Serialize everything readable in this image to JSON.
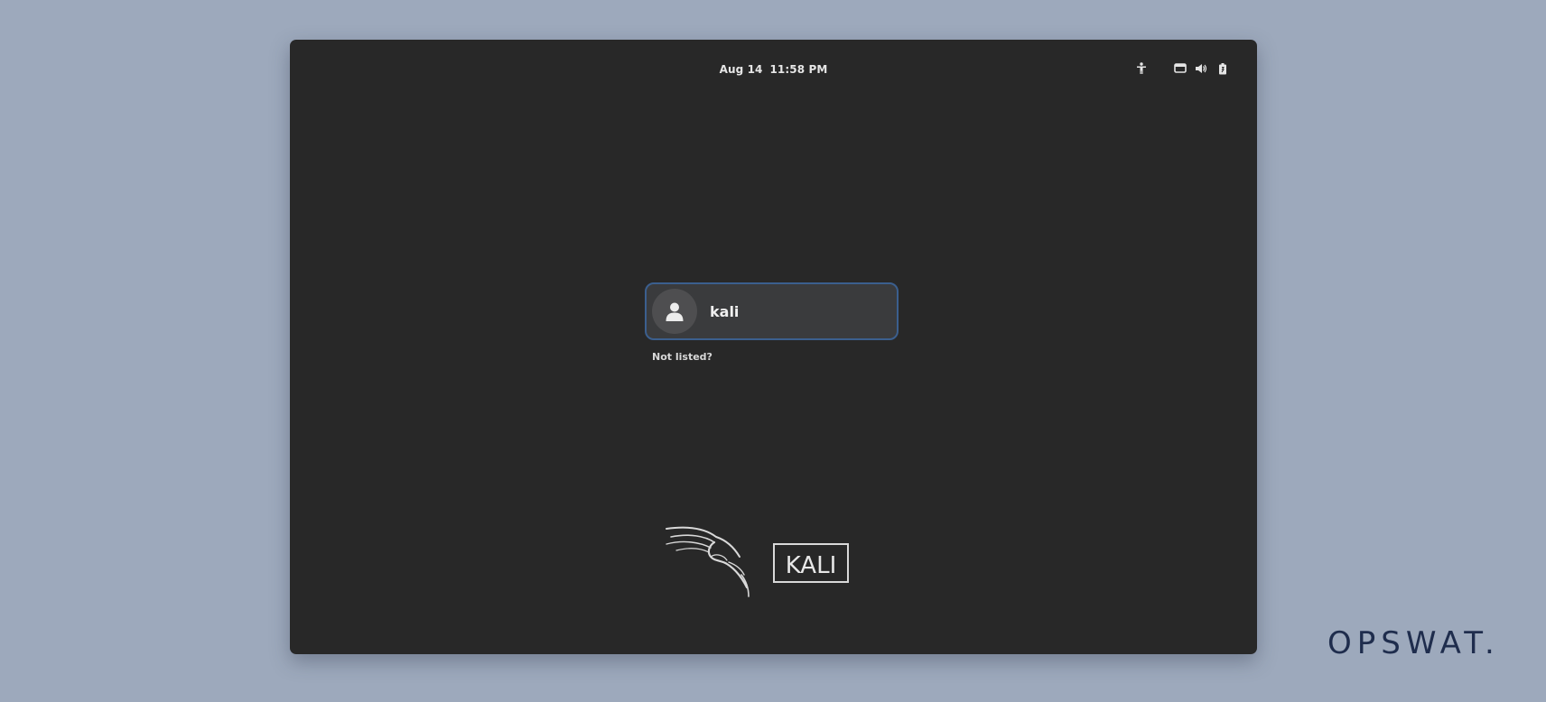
{
  "topbar": {
    "date": "Aug 14",
    "time": "11:58 PM",
    "icons": [
      "accessibility-icon",
      "display-icon",
      "volume-icon",
      "battery-icon"
    ]
  },
  "login": {
    "username": "kali",
    "avatar_icon": "user-icon",
    "not_listed_label": "Not listed?"
  },
  "branding": {
    "logo_text": "KALI",
    "watermark": "OPSWAT."
  },
  "colors": {
    "screen_bg": "#282828",
    "page_bg": "#9da9bc",
    "focus_border": "#3b5f8e",
    "watermark": "#1f2d4d"
  }
}
